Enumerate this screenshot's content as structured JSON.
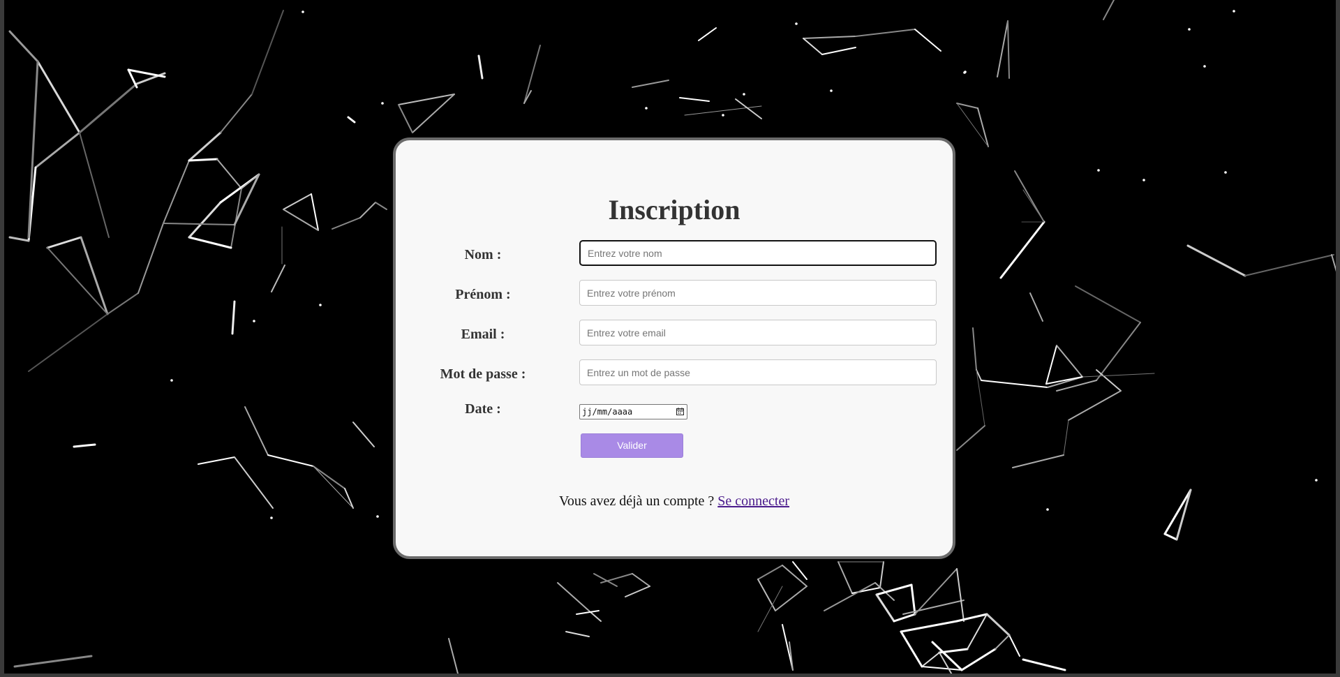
{
  "form": {
    "title": "Inscription",
    "fields": {
      "nom": {
        "label": "Nom :",
        "placeholder": "Entrez votre nom"
      },
      "prenom": {
        "label": "Prénom :",
        "placeholder": "Entrez votre prénom"
      },
      "email": {
        "label": "Email :",
        "placeholder": "Entrez votre email"
      },
      "password": {
        "label": "Mot de passe :",
        "placeholder": "Entrez un mot de passe"
      },
      "date": {
        "label": "Date :",
        "placeholder": "jj/mm/aaaa"
      }
    },
    "submit_label": "Valider",
    "footer_text": "Vous avez déjà un compte ? ",
    "footer_link": "Se connecter"
  },
  "colors": {
    "background": "#000000",
    "card": "#f8f8f8",
    "card_border": "#6b6b6b",
    "button": "#a98ae6",
    "link": "#4a1a8c"
  },
  "icons": {
    "date_picker": "calendar-icon"
  }
}
